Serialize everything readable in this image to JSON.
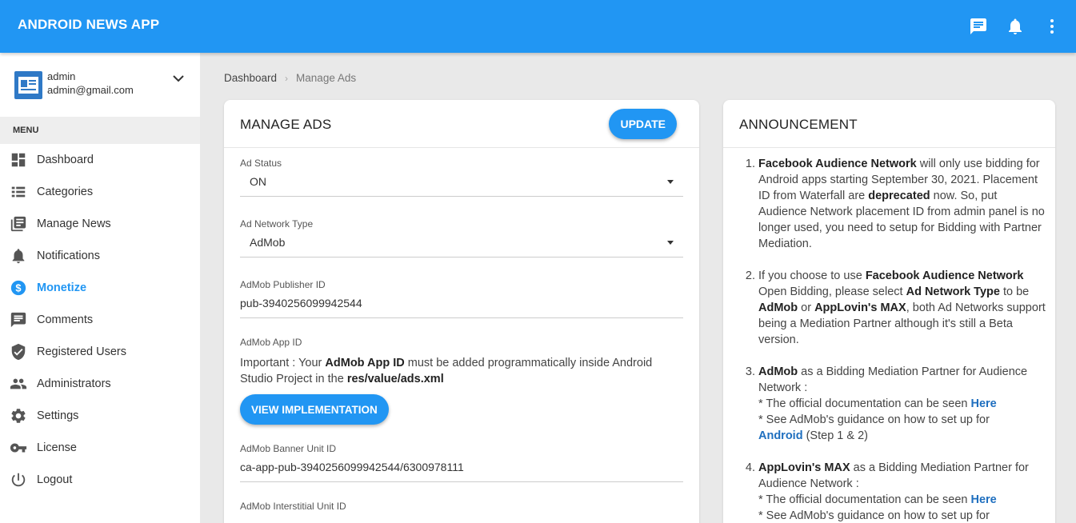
{
  "app": {
    "title": "ANDROID NEWS APP"
  },
  "user": {
    "name": "admin",
    "email": "admin@gmail.com"
  },
  "sidebar": {
    "menu_header": "MENU",
    "items": [
      {
        "label": "Dashboard",
        "icon": "dashboard-icon"
      },
      {
        "label": "Categories",
        "icon": "list-icon"
      },
      {
        "label": "Manage News",
        "icon": "news-icon"
      },
      {
        "label": "Notifications",
        "icon": "bell-icon"
      },
      {
        "label": "Monetize",
        "icon": "dollar-icon",
        "active": true
      },
      {
        "label": "Comments",
        "icon": "comment-icon"
      },
      {
        "label": "Registered Users",
        "icon": "shield-icon"
      },
      {
        "label": "Administrators",
        "icon": "people-icon"
      },
      {
        "label": "Settings",
        "icon": "gear-icon"
      },
      {
        "label": "License",
        "icon": "key-icon"
      },
      {
        "label": "Logout",
        "icon": "power-icon"
      }
    ]
  },
  "breadcrumb": {
    "home": "Dashboard",
    "current": "Manage Ads"
  },
  "manage_ads": {
    "title": "MANAGE ADS",
    "update_label": "UPDATE",
    "ad_status": {
      "label": "Ad Status",
      "value": "ON"
    },
    "ad_network_type": {
      "label": "Ad Network Type",
      "value": "AdMob"
    },
    "publisher_id": {
      "label": "AdMob Publisher ID",
      "value": "pub-3940256099942544"
    },
    "app_id": {
      "label": "AdMob App ID",
      "note_prefix": "Important : Your ",
      "note_bold1": "AdMob App ID",
      "note_middle": " must be added programmatically inside Android Studio Project in the ",
      "note_bold2": "res/value/ads.xml",
      "view_label": "VIEW IMPLEMENTATION"
    },
    "banner_unit_id": {
      "label": "AdMob Banner Unit ID",
      "value": "ca-app-pub-3940256099942544/6300978111"
    },
    "interstitial_unit_id": {
      "label": "AdMob Interstitial Unit ID"
    }
  },
  "announcement": {
    "title": "ANNOUNCEMENT",
    "item1": {
      "num": "1.",
      "b1": "Facebook Audience Network",
      "t1": " will only use bidding for Android apps starting September 30, 2021. Placement ID from Waterfall are ",
      "b2": "deprecated",
      "t2": " now. So, put Audience Network placement ID from admin panel is no longer used, you need to setup for Bidding with Partner Mediation."
    },
    "item2": {
      "num": "2.",
      "t1": "If you choose to use ",
      "b1": "Facebook Audience Network",
      "t2": " Open Bidding, please select ",
      "b2": "Ad Network Type",
      "t3": " to be ",
      "b3": "AdMob",
      "t4": " or ",
      "b4": "AppLovin's MAX",
      "t5": ", both Ad Networks support being a Mediation Partner although it's still a Beta version."
    },
    "item3": {
      "num": "3.",
      "b1": "AdMob",
      "t1": " as a Bidding Mediation Partner for Audience Network :",
      "l1": "* The official documentation can be seen ",
      "link1": "Here",
      "l2": "* See AdMob's guidance on how to set up for",
      "link2": "Android",
      "l2b": " (Step 1 & 2)"
    },
    "item4": {
      "num": "4.",
      "b1": "AppLovin's MAX",
      "t1": " as a Bidding Mediation Partner for Audience Network :",
      "l1": "* The official documentation can be seen ",
      "link1": "Here",
      "l2": "* See AdMob's guidance on how to set up for"
    }
  }
}
